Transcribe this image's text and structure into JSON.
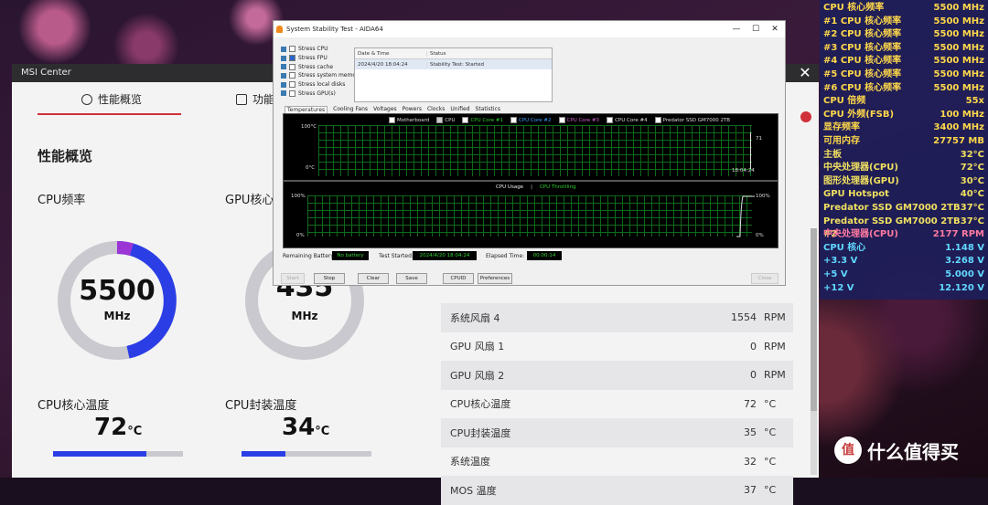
{
  "msi": {
    "title": "MSI Center",
    "close": "✕",
    "tabs": [
      {
        "label": "性能概览"
      },
      {
        "label": "功能"
      }
    ],
    "section_title": "性能概览",
    "cpu_freq": {
      "label": "CPU频率",
      "value": "5500",
      "unit": "MHz",
      "level": 0.4
    },
    "gpu_freq": {
      "label": "GPU核心",
      "value": "435",
      "unit": "MHz"
    },
    "cpu_core_temp": {
      "label": "CPU核心温度",
      "value": "72",
      "unit": "°C",
      "level": 0.72
    },
    "cpu_pkg_temp": {
      "label": "CPU封装温度",
      "value": "34",
      "unit": "°C",
      "level": 0.34
    },
    "table": [
      {
        "name": "系统风扇 4",
        "value": "1554",
        "unit": "RPM"
      },
      {
        "name": "GPU 风扇 1",
        "value": "0",
        "unit": "RPM"
      },
      {
        "name": "GPU 风扇 2",
        "value": "0",
        "unit": "RPM"
      },
      {
        "name": "CPU核心温度",
        "value": "72",
        "unit": "°C"
      },
      {
        "name": "CPU封装温度",
        "value": "35",
        "unit": "°C"
      },
      {
        "name": "系统温度",
        "value": "32",
        "unit": "°C"
      },
      {
        "name": "MOS 温度",
        "value": "37",
        "unit": "°C"
      }
    ]
  },
  "aida": {
    "title": "System Stability Test - AIDA64",
    "min": "—",
    "max": "☐",
    "close": "✕",
    "stress": [
      {
        "label": "Stress CPU",
        "checked": false
      },
      {
        "label": "Stress FPU",
        "checked": true
      },
      {
        "label": "Stress cache",
        "checked": false
      },
      {
        "label": "Stress system memory",
        "checked": false
      },
      {
        "label": "Stress local disks",
        "checked": false
      },
      {
        "label": "Stress GPU(s)",
        "checked": false
      }
    ],
    "status_header": {
      "date": "Date & Time",
      "status": "Status"
    },
    "status_row": {
      "date": "2024/4/20 18:04:24",
      "status": "Stability Test: Started"
    },
    "tabs": [
      "Temperatures",
      "Cooling Fans",
      "Voltages",
      "Powers",
      "Clocks",
      "Unified",
      "Statistics"
    ],
    "temp_legend": [
      "Motherboard",
      "CPU",
      "CPU Core #1",
      "CPU Core #2",
      "CPU Core #3",
      "CPU Core #4",
      "Predator SSD GM7000 2TB"
    ],
    "temp_graph": {
      "ymax": "100°C",
      "ymin": "0°C",
      "time": "18:04:24",
      "readout": "71"
    },
    "usage_legend": {
      "a": "CPU Usage",
      "sep": "|",
      "b": "CPU Throttling"
    },
    "usage_graph": {
      "ymax_l": "100%",
      "ymin_l": "0%",
      "ymax_r": "100%",
      "ymin_r": "0%"
    },
    "battery_label": "Remaining Battery:",
    "battery_value": "No battery",
    "started_label": "Test Started:",
    "started_value": "2024/4/20 18:04:24",
    "elapsed_label": "Elapsed Time:",
    "elapsed_value": "00:00:14",
    "buttons": {
      "start": "Start",
      "stop": "Stop",
      "clear": "Clear",
      "save": "Save",
      "cpuid": "CPUID",
      "prefs": "Preferences",
      "close": "Close"
    }
  },
  "osd": [
    {
      "label": "CPU 核心频率",
      "value": "5500 MHz",
      "color": "#ffd84a"
    },
    {
      "label": "#1 CPU 核心频率",
      "value": "5500 MHz",
      "color": "#ffd84a"
    },
    {
      "label": "#2 CPU 核心频率",
      "value": "5500 MHz",
      "color": "#ffd84a"
    },
    {
      "label": "#3 CPU 核心频率",
      "value": "5500 MHz",
      "color": "#ffd84a"
    },
    {
      "label": "#4 CPU 核心频率",
      "value": "5500 MHz",
      "color": "#ffd84a"
    },
    {
      "label": "#5 CPU 核心频率",
      "value": "5500 MHz",
      "color": "#ffd84a"
    },
    {
      "label": "#6 CPU 核心频率",
      "value": "5500 MHz",
      "color": "#ffd84a"
    },
    {
      "label": "CPU 倍频",
      "value": "55x",
      "color": "#ffd84a"
    },
    {
      "label": "CPU 外频(FSB)",
      "value": "100 MHz",
      "color": "#ffd84a"
    },
    {
      "label": "显存频率",
      "value": "3400 MHz",
      "color": "#ffd84a"
    },
    {
      "label": "可用内存",
      "value": "27757 MB",
      "color": "#ffd84a"
    },
    {
      "label": "主板",
      "value": "32°C",
      "color": "#f0e060"
    },
    {
      "label": "中央处理器(CPU)",
      "value": "72°C",
      "color": "#f0e060"
    },
    {
      "label": "图形处理器(GPU)",
      "value": "30°C",
      "color": "#f0e060"
    },
    {
      "label": "GPU Hotspot",
      "value": "40°C",
      "color": "#f0e060"
    },
    {
      "label": "Predator SSD GM7000 2TB",
      "value": "37°C",
      "color": "#f0e060"
    },
    {
      "label": "Predator SSD GM7000 2TB #2",
      "value": "37°C",
      "color": "#f0e060"
    },
    {
      "label": "中央处理器(CPU)",
      "value": "2177 RPM",
      "color": "#ff7aa0"
    },
    {
      "label": "CPU 核心",
      "value": "1.148 V",
      "color": "#60d8ff"
    },
    {
      "label": "+3.3 V",
      "value": "3.268 V",
      "color": "#60d8ff"
    },
    {
      "label": "+5 V",
      "value": "5.000 V",
      "color": "#60d8ff"
    },
    {
      "label": "+12 V",
      "value": "12.120 V",
      "color": "#60d8ff"
    }
  ],
  "watermark": {
    "logo": "值",
    "text": "什么值得买"
  }
}
